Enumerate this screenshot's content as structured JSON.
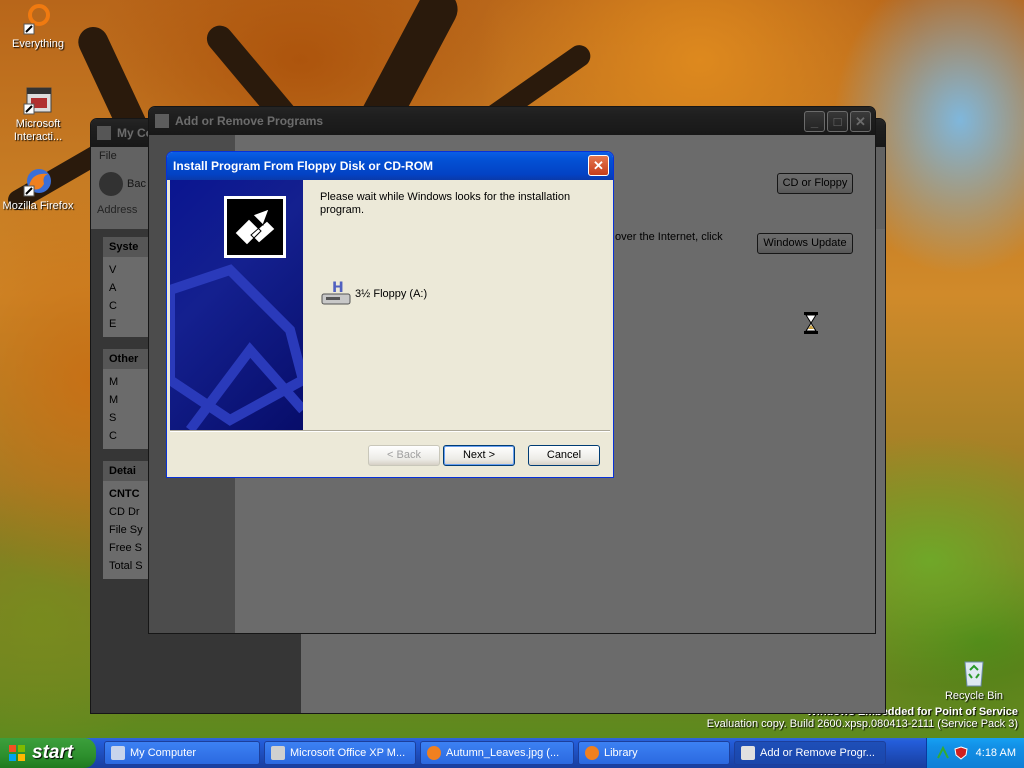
{
  "desktop": {
    "icons": [
      {
        "label": "Everything"
      },
      {
        "label": "Microsoft Interacti..."
      },
      {
        "label": "Mozilla Firefox"
      },
      {
        "label": "Recycle Bin"
      }
    ],
    "watermark_line1": "Windows Embedded for Point of Service",
    "watermark_line2": "Evaluation copy. Build 2600.xpsp.080413-2111 (Service Pack 3)"
  },
  "my_computer": {
    "title": "My Co",
    "menu_label": "File",
    "back_label": "Bac",
    "address_label": "Address",
    "sections": [
      {
        "heading": "Syste",
        "items": [
          "V",
          "A",
          "C",
          "E"
        ]
      },
      {
        "heading": "Other",
        "items": [
          "M",
          "M",
          "S",
          "C"
        ]
      },
      {
        "heading": "Detai",
        "items": [
          "CNTC",
          "CD Dr",
          "File Sy",
          "Free S",
          "Total S"
        ]
      }
    ],
    "side_letters": [
      "A",
      "C"
    ]
  },
  "add_remove": {
    "title": "Add or Remove Programs",
    "cd_button": "CD or Floppy",
    "internet_text": "over the Internet, click",
    "update_button": "Windows Update"
  },
  "dialog": {
    "title": "Install Program From Floppy Disk or CD-ROM",
    "message": "Please wait while Windows looks for the installation program.",
    "drive_label": "3½ Floppy (A:)",
    "back_button": "< Back",
    "next_button": "Next >",
    "cancel_button": "Cancel"
  },
  "taskbar": {
    "start_label": "start",
    "tasks": [
      {
        "label": "My Computer",
        "icon": "computer-icon"
      },
      {
        "label": "Microsoft Office XP M...",
        "icon": "installer-icon"
      },
      {
        "label": "Autumn_Leaves.jpg (...",
        "icon": "firefox-icon"
      },
      {
        "label": "Library",
        "icon": "firefox-icon"
      },
      {
        "label": "Add or Remove Progr...",
        "icon": "add-remove-icon"
      }
    ],
    "clock": "4:18 AM"
  },
  "colors": {
    "xp_blue": "#0a5fe6",
    "start_green": "#2d8f2d",
    "task_pane_orange": "#e07a1a",
    "dialog_banner_navy": "#0a1590"
  }
}
